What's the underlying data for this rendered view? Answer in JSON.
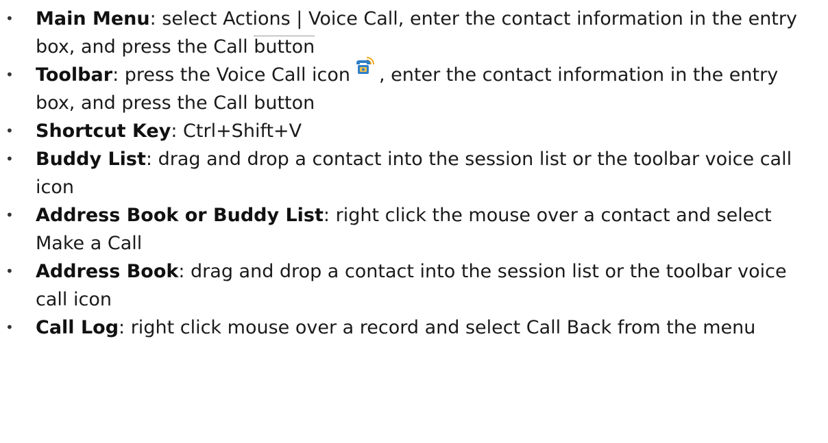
{
  "items": [
    {
      "term": "Main Menu",
      "text_before": ": select Actions | Voice Call, enter the contact information in the entry box, and press the Call ",
      "text_underlined": "button",
      "text_after": ""
    },
    {
      "term": "Toolbar",
      "text_before": ": press the Voice Call icon",
      "icon": "voice-call-phone-icon",
      "text_after": ", enter the contact information in the entry box, and press the Call button"
    },
    {
      "term": "Shortcut Key",
      "text": ": Ctrl+Shift+V"
    },
    {
      "term": "Buddy List",
      "text": ": drag and drop a contact into the session list or the toolbar voice call icon"
    },
    {
      "term": "Address Book or Buddy List",
      "text": ": right click the mouse over a contact and select Make a Call"
    },
    {
      "term": "Address Book",
      "text": ": drag and drop a contact into the session list or the toolbar voice call icon"
    },
    {
      "term": "Call Log",
      "text": ": right click mouse over a record and select Call Back from the menu"
    }
  ],
  "colors": {
    "icon_body": "#2f7fc7",
    "icon_signal": "#f2a81d"
  }
}
